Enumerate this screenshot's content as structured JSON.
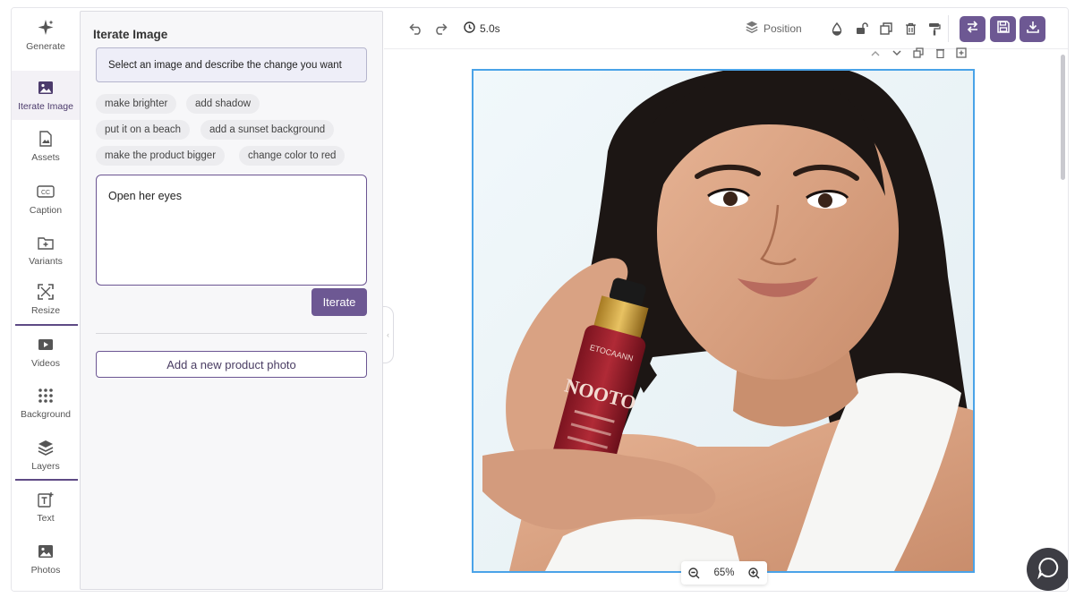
{
  "rail": {
    "items": [
      {
        "label": "Generate",
        "icon": "sparkle-icon"
      },
      {
        "label": "Iterate Image",
        "icon": "image-icon",
        "active": true
      },
      {
        "label": "Assets",
        "icon": "assets-icon"
      },
      {
        "label": "Caption",
        "icon": "caption-icon"
      },
      {
        "label": "Variants",
        "icon": "folder-plus-icon"
      },
      {
        "label": "Resize",
        "icon": "resize-icon"
      },
      {
        "label": "Videos",
        "icon": "video-icon"
      },
      {
        "label": "Background",
        "icon": "grid-dots-icon"
      },
      {
        "label": "Layers",
        "icon": "layers-icon"
      },
      {
        "label": "Text",
        "icon": "text-icon"
      },
      {
        "label": "Photos",
        "icon": "photos-icon"
      }
    ]
  },
  "panel": {
    "title": "Iterate Image",
    "hint": "Select an image and describe the change you want",
    "chips": [
      "make brighter",
      "add shadow",
      "put it on a beach",
      "add a sunset background",
      "make the product bigger",
      "change color to red"
    ],
    "prompt_value": "Open her eyes",
    "iterate_label": "Iterate",
    "add_photo_label": "Add a new product photo"
  },
  "toolbar": {
    "timer": "5.0s",
    "position_label": "Position"
  },
  "canvas": {
    "zoom": "65%",
    "product_label_top": "ETOCAANN",
    "product_label_main": "NOOTO"
  },
  "colors": {
    "accent": "#6d5893",
    "selection": "#4aa3e8"
  }
}
